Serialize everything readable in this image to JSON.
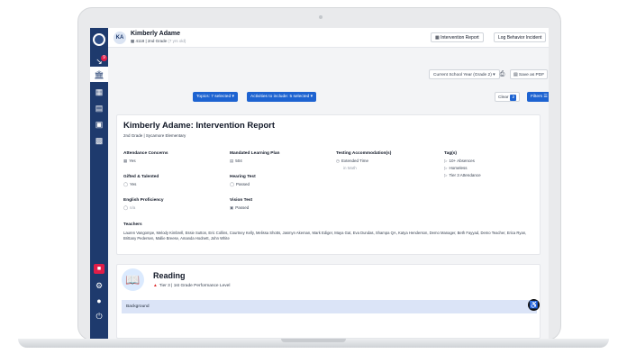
{
  "header": {
    "avatar_initials": "KA",
    "student_name": "Kimberly Adame",
    "student_id": "4118",
    "student_grade": "2nd Grade",
    "student_age": "(7 yrs old)",
    "intervention_report_label": "Intervention Report",
    "log_behavior_label": "Log Behavior Incident"
  },
  "toolbar": {
    "year_select": "Current School Year (Grade 2)",
    "save_pdf_label": "Save as PDF",
    "topics_chip": "Topics: 7 selected",
    "activities_chip": "Activities to include: 5 selected",
    "clear_label": "Clear",
    "clear_count": "2",
    "filters_label": "Filters"
  },
  "sidebar": {
    "notification_count": "9"
  },
  "report": {
    "title": "Kimberly Adame: Intervention Report",
    "subtitle": "2nd Grade | Sycamore Elementary",
    "fields": {
      "attendance_label": "Attendance Concerns",
      "attendance_value": "Yes",
      "learning_plan_label": "Mandated Learning Plan",
      "learning_plan_value": "504",
      "testing_label": "Testing Accommodation(s)",
      "testing_value": "Extended Time",
      "testing_sub": "in Math",
      "tags_label": "Tag(s)",
      "tag_1": "10+ Absences",
      "tag_2": "Homeless",
      "tag_3": "Tier 3 Attendance",
      "gifted_label": "Gifted & Talented",
      "gifted_value": "Yes",
      "hearing_label": "Hearing Test",
      "hearing_value": "Passed",
      "english_label": "English Proficiency",
      "english_value": "n/a",
      "vision_label": "Vision Test",
      "vision_value": "Passed"
    },
    "teachers_label": "Teachers",
    "teachers_list": "Lauren Vangompe, Melody Kimbrell, Essie Sutton, Eric Collins, Courtney Kelly, Melissa Shotts, Jasmyn Akeman, Mark Ediger, Maya Gat, Eva Dundas, Shampa QA, Katya Henderson, Demo Manager, Beth Fayyad, Demo Teacher, Erica Ryan, Brittany Pedersen, Mallie Breese, Amanda Hodnett, John White"
  },
  "reading": {
    "title": "Reading",
    "tier": "Tier 3 | 1st Grade Performance Level",
    "background_label": "Background"
  },
  "colors": {
    "sidebar": "#1e3a6d",
    "accent": "#1d63d1",
    "alert": "#e11d48"
  }
}
